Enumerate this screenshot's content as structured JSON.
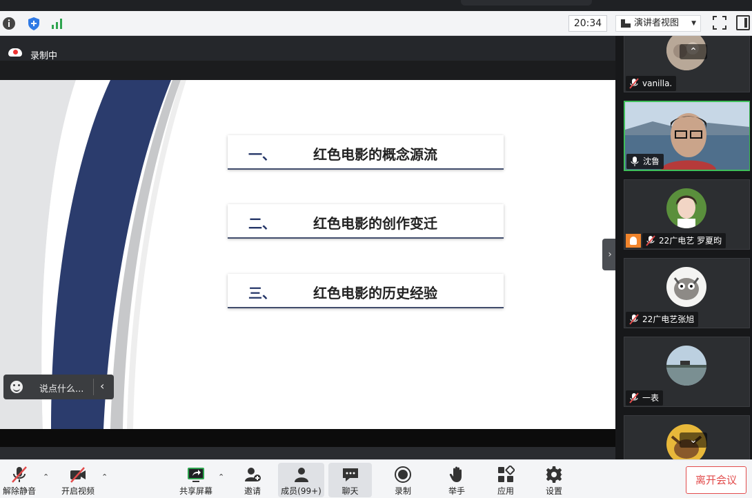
{
  "topbar": {
    "time": "20:34",
    "view_label": "演讲者视图"
  },
  "recording": {
    "label": "录制中"
  },
  "slide": {
    "items": [
      {
        "num": "一、",
        "text": "红色电影的概念源流"
      },
      {
        "num": "二、",
        "text": "红色电影的创作变迁"
      },
      {
        "num": "三、",
        "text": "红色电影的历史经验"
      }
    ]
  },
  "chat": {
    "placeholder": "说点什么..."
  },
  "participants": [
    {
      "name": "vanilla.",
      "muted": true
    },
    {
      "name": "沈鲁",
      "muted": false,
      "speaking": true
    },
    {
      "name": "22广电艺 罗夏昀",
      "muted": true,
      "host": true
    },
    {
      "name": "22广电艺张旭",
      "muted": true
    },
    {
      "name": "一表",
      "muted": true
    }
  ],
  "toolbar": {
    "mute": "解除静音",
    "video": "开启视频",
    "share": "共享屏幕",
    "invite": "邀请",
    "members": "成员(99+)",
    "chat": "聊天",
    "record": "录制",
    "raise_hand": "举手",
    "apps": "应用",
    "settings": "设置",
    "leave": "离开会议"
  },
  "colors": {
    "accent_navy": "#243567",
    "active_green": "#3fbf5a",
    "leave_red": "#e24b4b"
  }
}
